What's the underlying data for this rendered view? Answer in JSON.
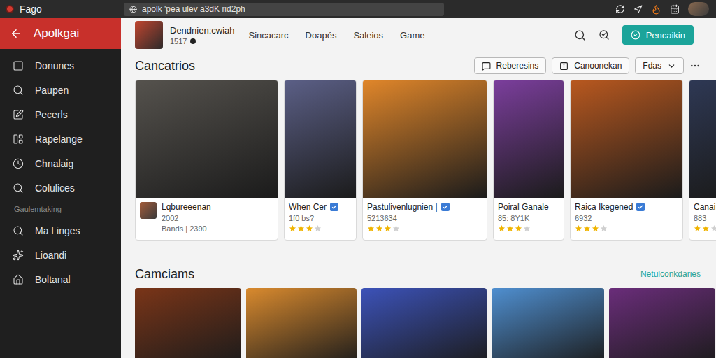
{
  "window": {
    "title": "Fago",
    "address": "apolk 'pea ulev a3dK rid2ph"
  },
  "sidebar": {
    "title": "Apolkgai",
    "items": [
      {
        "label": "Donunes",
        "kind": "item",
        "selected": false
      },
      {
        "label": "Paupen",
        "kind": "item",
        "selected": false
      },
      {
        "label": "Pecerls",
        "kind": "item",
        "selected": false
      },
      {
        "label": "Rapelange",
        "kind": "item",
        "selected": false
      },
      {
        "label": "Chnalaig",
        "kind": "item",
        "selected": false
      },
      {
        "label": "Colulices",
        "kind": "item",
        "selected": false
      },
      {
        "label": "Gaulemtaking",
        "kind": "heading",
        "selected": false
      },
      {
        "label": "Ma Linges",
        "kind": "item",
        "selected": false
      },
      {
        "label": "Lioandi",
        "kind": "item",
        "selected": false
      },
      {
        "label": "Boltanal",
        "kind": "item",
        "selected": false
      }
    ]
  },
  "header": {
    "profile": {
      "name": "Dendnien:cwiah",
      "sub": "1517"
    },
    "nav": [
      {
        "label": "Sincacarc",
        "selected": false
      },
      {
        "label": "Doapés",
        "selected": false
      },
      {
        "label": "Saleios",
        "selected": false
      },
      {
        "label": "Game",
        "selected": false
      }
    ],
    "button": "Pencaikin"
  },
  "featured": {
    "title": "Cancatrios",
    "filters": [
      "Reberesins",
      "Canoonekan"
    ],
    "dropdown": "Fdas",
    "cards": [
      {
        "kind": "profile",
        "title": "Lqbureeenan",
        "sub": "2002",
        "meta": "Bands | 2390",
        "verified": false,
        "stars": 0,
        "color": "#55524d"
      },
      {
        "kind": "rating",
        "title": "When Cer",
        "sub": "1f0 bs?",
        "meta": "",
        "verified": true,
        "stars": 3,
        "color": "#5b5f86"
      },
      {
        "kind": "rating",
        "title": "Pastulivenlugnien |",
        "sub": "5213634",
        "meta": "",
        "verified": true,
        "stars": 3,
        "color": "#e0862a"
      },
      {
        "kind": "rating",
        "title": "Poiral Ganale",
        "sub": "85: 8Y1K",
        "meta": "",
        "verified": false,
        "stars": 3,
        "color": "#7b3e9c"
      },
      {
        "kind": "rating",
        "title": "Raica Ikegened",
        "sub": "6932",
        "meta": "",
        "verified": true,
        "stars": 3,
        "color": "#b8581f"
      },
      {
        "kind": "rating",
        "title": "Canai",
        "sub": "883",
        "meta": "",
        "verified": false,
        "stars": 2,
        "color": "#2e3854"
      }
    ]
  },
  "more": {
    "title": "Camciams",
    "link": "Netulconkdaries",
    "cards": [
      {
        "color": "#7a3518"
      },
      {
        "color": "#d98a2e"
      },
      {
        "color": "#3c52b8"
      },
      {
        "color": "#4f8fd0"
      },
      {
        "color": "#6a2d7a"
      }
    ]
  }
}
